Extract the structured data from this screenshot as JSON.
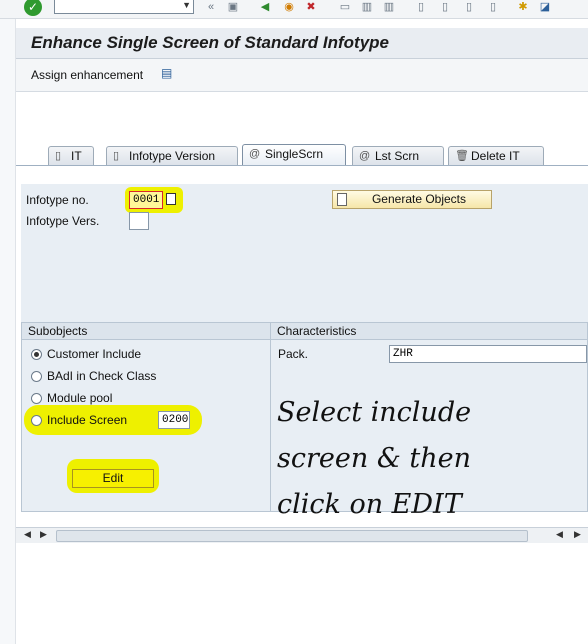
{
  "title": "Enhance Single Screen of Standard Infotype",
  "app_toolbar": {
    "assign_label": "Assign enhancement"
  },
  "tabs": [
    {
      "label": "IT",
      "icon": "document-icon",
      "active": false
    },
    {
      "label": "Infotype Version",
      "icon": "document-icon",
      "active": false
    },
    {
      "label": "SingleScrn",
      "icon": "spiral-icon",
      "active": true
    },
    {
      "label": "Lst Scrn",
      "icon": "spiral-icon",
      "active": false
    },
    {
      "label": "Delete IT",
      "icon": "trash-icon",
      "active": false
    }
  ],
  "header": {
    "infotype_no_label": "Infotype no.",
    "infotype_no_value": "0001",
    "infotype_vers_label": "Infotype Vers.",
    "infotype_vers_value": "",
    "generate_button": "Generate Objects"
  },
  "subobjects": {
    "heading": "Subobjects",
    "options": [
      {
        "label": "Customer Include",
        "selected": true
      },
      {
        "label": "BAdI in Check Class",
        "selected": false
      },
      {
        "label": "Module pool",
        "selected": false
      },
      {
        "label": "Include Screen",
        "selected": false
      }
    ],
    "include_screen_value": "0200",
    "edit_button": "Edit"
  },
  "characteristics": {
    "heading": "Characteristics",
    "pack_label": "Pack.",
    "pack_value": "ZHR"
  },
  "annotation": {
    "line1": "Select include",
    "line2": "screen & then",
    "line3": "click on EDIT"
  },
  "colors": {
    "highlight": "#eef000",
    "button": "#f6e6a9"
  }
}
